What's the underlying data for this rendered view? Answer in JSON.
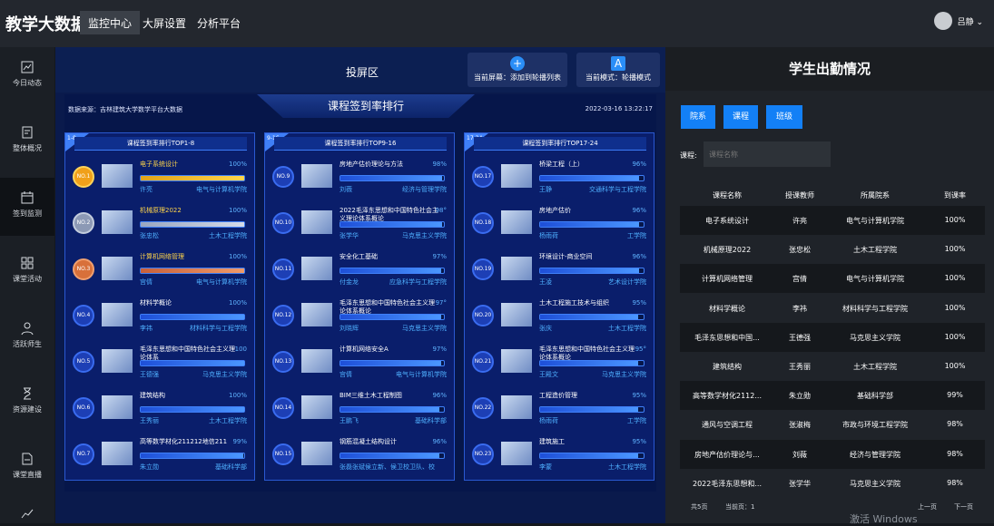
{
  "brand": "教学大数据",
  "nav": {
    "tabs": [
      "监控中心",
      "大屏设置",
      "分析平台"
    ]
  },
  "user": {
    "name": "吕静 ⌄"
  },
  "sidebar": {
    "items": [
      "今日动态",
      "整体概况",
      "签到监测",
      "课堂活动",
      "活跃师生",
      "资源建设",
      "课堂直播"
    ]
  },
  "screen": {
    "title": "投屏区",
    "mode_btn1": "当前屏幕：添加到轮播列表",
    "mode_btn1_icon": "+",
    "mode_btn2": "当前模式：轮播模式",
    "mode_btn2_icon": "A"
  },
  "board": {
    "datasrc": "数据来源：吉林建筑大学数学平台大数据",
    "title": "课程签到率排行",
    "time": "2022-03-16 13:22:17",
    "panels": [
      {
        "tag": "1-8",
        "title": "课程签到率排行TOP1-8",
        "items": [
          {
            "no": "NO.1",
            "name": "电子系统设计",
            "rate": "100%",
            "teacher": "许亮",
            "dept": "电气与计算机学院",
            "fill": 1.0
          },
          {
            "no": "NO.2",
            "name": "机械原理2022",
            "rate": "100%",
            "teacher": "张忠松",
            "dept": "土木工程学院",
            "fill": 1.0
          },
          {
            "no": "NO.3",
            "name": "计算机网络管理",
            "rate": "100%",
            "teacher": "宫倩",
            "dept": "电气与计算机学院",
            "fill": 1.0
          },
          {
            "no": "NO.4",
            "name": "材料学概论",
            "rate": "100%",
            "teacher": "李祎",
            "dept": "材料科学与工程学院",
            "fill": 1.0
          },
          {
            "no": "NO.5",
            "name": "毛泽东思想和中国特色社会主义理论体系",
            "rate": "100",
            "teacher": "王德强",
            "dept": "马克思主义学院",
            "fill": 1.0
          },
          {
            "no": "NO.6",
            "name": "建筑结构",
            "rate": "100%",
            "teacher": "王秀丽",
            "dept": "土木工程学院",
            "fill": 1.0
          },
          {
            "no": "NO.7",
            "name": "高等数学材化211212地信211",
            "rate": "99%",
            "teacher": "朱立勋",
            "dept": "基础科学部",
            "fill": 0.99
          }
        ]
      },
      {
        "tag": "9-16",
        "title": "课程签到率排行TOP9-16",
        "items": [
          {
            "no": "NO.9",
            "name": "房地产估价理论与方法",
            "rate": "98%",
            "teacher": "刘薇",
            "dept": "经济与管理学院",
            "fill": 0.98
          },
          {
            "no": "NO.10",
            "name": "2022毛泽东思想和中国特色社会主义理论体系概论",
            "rate": "98°",
            "teacher": "张学华",
            "dept": "马克思主义学院",
            "fill": 0.98
          },
          {
            "no": "NO.11",
            "name": "安全化工基础",
            "rate": "97%",
            "teacher": "付金龙",
            "dept": "应急科学与工程学院",
            "fill": 0.97
          },
          {
            "no": "NO.12",
            "name": "毛泽东思想和中国特色社会主义理论体系概论",
            "rate": "97°",
            "teacher": "刘晓辉",
            "dept": "马克思主义学院",
            "fill": 0.97
          },
          {
            "no": "NO.13",
            "name": "计算机网络安全A",
            "rate": "97%",
            "teacher": "宫倩",
            "dept": "电气与计算机学院",
            "fill": 0.97
          },
          {
            "no": "NO.14",
            "name": "BIM三维土木工程制图",
            "rate": "96%",
            "teacher": "王鹏飞",
            "dept": "基础科学部",
            "fill": 0.96
          },
          {
            "no": "NO.15",
            "name": "钢筋混凝土结构设计",
            "rate": "96%",
            "teacher": "张磊张斌侯立新、侯卫校卫队、校",
            "dept": "",
            "fill": 0.96
          }
        ]
      },
      {
        "tag": "17-24",
        "title": "课程签到率排行TOP17-24",
        "items": [
          {
            "no": "NO.17",
            "name": "桥梁工程（上）",
            "rate": "96%",
            "teacher": "王静",
            "dept": "交通科学与工程学院",
            "fill": 0.96
          },
          {
            "no": "NO.18",
            "name": "房地产估价",
            "rate": "96%",
            "teacher": "杨雨荷",
            "dept": "工学院",
            "fill": 0.96
          },
          {
            "no": "NO.19",
            "name": "环境设计-商业空间",
            "rate": "96%",
            "teacher": "王凌",
            "dept": "艺术设计学院",
            "fill": 0.96
          },
          {
            "no": "NO.20",
            "name": "土木工程施工技术与组织",
            "rate": "95%",
            "teacher": "张庆",
            "dept": "土木工程学院",
            "fill": 0.95
          },
          {
            "no": "NO.21",
            "name": "毛泽东思想和中国特色社会主义理论体系概论",
            "rate": "95°",
            "teacher": "王殿文",
            "dept": "马克思主义学院",
            "fill": 0.95
          },
          {
            "no": "NO.22",
            "name": "工程造价管理",
            "rate": "95%",
            "teacher": "杨雨荷",
            "dept": "工学院",
            "fill": 0.95
          },
          {
            "no": "NO.23",
            "name": "建筑施工",
            "rate": "95%",
            "teacher": "李蒙",
            "dept": "土木工程学院",
            "fill": 0.95
          }
        ]
      }
    ]
  },
  "attendance": {
    "title": "学生出勤情况",
    "filters": [
      "院系",
      "课程",
      "班级"
    ],
    "course_label": "课程:",
    "course_placeholder": "课程名称",
    "headers": [
      "课程名称",
      "授课教师",
      "所属院系",
      "到课率"
    ],
    "rows": [
      [
        "电子系统设计",
        "许亮",
        "电气与计算机学院",
        "100%"
      ],
      [
        "机械原理2022",
        "张忠松",
        "土木工程学院",
        "100%"
      ],
      [
        "计算机网络管理",
        "宫倩",
        "电气与计算机学院",
        "100%"
      ],
      [
        "材料学概论",
        "李祎",
        "材料科学与工程学院",
        "100%"
      ],
      [
        "毛泽东思想和中国...",
        "王德强",
        "马克思主义学院",
        "100%"
      ],
      [
        "建筑结构",
        "王秀丽",
        "土木工程学院",
        "100%"
      ],
      [
        "高等数学材化2112...",
        "朱立勋",
        "基础科学部",
        "99%"
      ],
      [
        "通风与空调工程",
        "张淑梅",
        "市政与环境工程学院",
        "98%"
      ],
      [
        "房地产估价理论与...",
        "刘薇",
        "经济与管理学院",
        "98%"
      ],
      [
        "2022毛泽东思想和...",
        "张学华",
        "马克思主义学院",
        "98%"
      ]
    ],
    "pager": {
      "total": "共5页",
      "current": "当前页：1",
      "prev": "上一页",
      "next": "下一页"
    }
  },
  "watermark": "激活 Windows"
}
